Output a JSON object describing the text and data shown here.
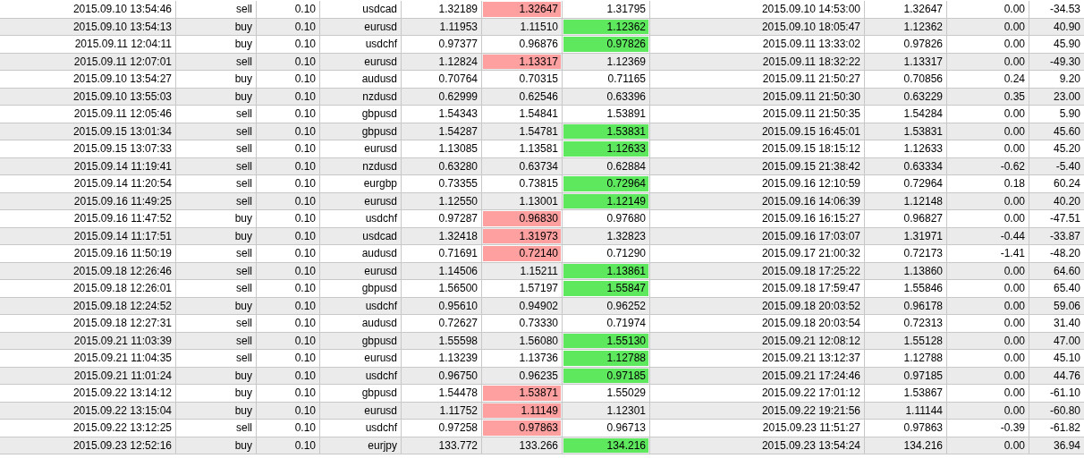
{
  "table": {
    "rows": [
      {
        "cells": [
          "2015.09.10 13:54:46",
          "sell",
          "0.10",
          "usdcad",
          "1.32189",
          "1.32647",
          "1.31795",
          "2015.09.10 14:53:00",
          "1.32647",
          "0.00",
          "-34.53"
        ],
        "column_6_hit": true,
        "column_7_hit": false
      },
      {
        "cells": [
          "2015.09.10 13:54:13",
          "buy",
          "0.10",
          "eurusd",
          "1.11953",
          "1.11510",
          "1.12362",
          "2015.09.10 18:05:47",
          "1.12362",
          "0.00",
          "40.90"
        ],
        "column_6_hit": false,
        "column_7_hit": true
      },
      {
        "cells": [
          "2015.09.11 12:04:11",
          "buy",
          "0.10",
          "usdchf",
          "0.97377",
          "0.96876",
          "0.97826",
          "2015.09.11 13:33:02",
          "0.97826",
          "0.00",
          "45.90"
        ],
        "column_6_hit": false,
        "column_7_hit": true
      },
      {
        "cells": [
          "2015.09.11 12:07:01",
          "sell",
          "0.10",
          "eurusd",
          "1.12824",
          "1.13317",
          "1.12369",
          "2015.09.11 18:32:22",
          "1.13317",
          "0.00",
          "-49.30"
        ],
        "column_6_hit": true,
        "column_7_hit": false
      },
      {
        "cells": [
          "2015.09.10 13:54:27",
          "buy",
          "0.10",
          "audusd",
          "0.70764",
          "0.70315",
          "0.71165",
          "2015.09.11 21:50:27",
          "0.70856",
          "0.24",
          "9.20"
        ],
        "column_6_hit": false,
        "column_7_hit": false
      },
      {
        "cells": [
          "2015.09.10 13:55:03",
          "buy",
          "0.10",
          "nzdusd",
          "0.62999",
          "0.62546",
          "0.63396",
          "2015.09.11 21:50:30",
          "0.63229",
          "0.35",
          "23.00"
        ],
        "column_6_hit": false,
        "column_7_hit": false
      },
      {
        "cells": [
          "2015.09.11 12:05:46",
          "sell",
          "0.10",
          "gbpusd",
          "1.54343",
          "1.54841",
          "1.53891",
          "2015.09.11 21:50:35",
          "1.54284",
          "0.00",
          "5.90"
        ],
        "column_6_hit": false,
        "column_7_hit": false
      },
      {
        "cells": [
          "2015.09.15 13:01:34",
          "sell",
          "0.10",
          "gbpusd",
          "1.54287",
          "1.54781",
          "1.53831",
          "2015.09.15 16:45:01",
          "1.53831",
          "0.00",
          "45.60"
        ],
        "column_6_hit": false,
        "column_7_hit": true
      },
      {
        "cells": [
          "2015.09.15 13:07:33",
          "sell",
          "0.10",
          "eurusd",
          "1.13085",
          "1.13581",
          "1.12633",
          "2015.09.15 18:15:12",
          "1.12633",
          "0.00",
          "45.20"
        ],
        "column_6_hit": false,
        "column_7_hit": true
      },
      {
        "cells": [
          "2015.09.14 11:19:41",
          "sell",
          "0.10",
          "nzdusd",
          "0.63280",
          "0.63734",
          "0.62884",
          "2015.09.15 21:38:42",
          "0.63334",
          "-0.62",
          "-5.40"
        ],
        "column_6_hit": false,
        "column_7_hit": false
      },
      {
        "cells": [
          "2015.09.14 11:20:54",
          "sell",
          "0.10",
          "eurgbp",
          "0.73355",
          "0.73815",
          "0.72964",
          "2015.09.16 12:10:59",
          "0.72964",
          "0.18",
          "60.24"
        ],
        "column_6_hit": false,
        "column_7_hit": true
      },
      {
        "cells": [
          "2015.09.16 11:49:25",
          "sell",
          "0.10",
          "eurusd",
          "1.12550",
          "1.13001",
          "1.12149",
          "2015.09.16 14:06:39",
          "1.12148",
          "0.00",
          "40.20"
        ],
        "column_6_hit": false,
        "column_7_hit": true
      },
      {
        "cells": [
          "2015.09.16 11:47:52",
          "buy",
          "0.10",
          "usdchf",
          "0.97287",
          "0.96830",
          "0.97680",
          "2015.09.16 16:15:27",
          "0.96827",
          "0.00",
          "-47.51"
        ],
        "column_6_hit": true,
        "column_7_hit": false
      },
      {
        "cells": [
          "2015.09.14 11:17:51",
          "buy",
          "0.10",
          "usdcad",
          "1.32418",
          "1.31973",
          "1.32823",
          "2015.09.16 17:03:07",
          "1.31971",
          "-0.44",
          "-33.87"
        ],
        "column_6_hit": true,
        "column_7_hit": false
      },
      {
        "cells": [
          "2015.09.16 11:50:19",
          "sell",
          "0.10",
          "audusd",
          "0.71691",
          "0.72140",
          "0.71290",
          "2015.09.17 21:00:32",
          "0.72173",
          "-1.41",
          "-48.20"
        ],
        "column_6_hit": true,
        "column_7_hit": false
      },
      {
        "cells": [
          "2015.09.18 12:26:46",
          "sell",
          "0.10",
          "eurusd",
          "1.14506",
          "1.15211",
          "1.13861",
          "2015.09.18 17:25:22",
          "1.13860",
          "0.00",
          "64.60"
        ],
        "column_6_hit": false,
        "column_7_hit": true
      },
      {
        "cells": [
          "2015.09.18 12:26:01",
          "sell",
          "0.10",
          "gbpusd",
          "1.56500",
          "1.57197",
          "1.55847",
          "2015.09.18 17:59:47",
          "1.55846",
          "0.00",
          "65.40"
        ],
        "column_6_hit": false,
        "column_7_hit": true
      },
      {
        "cells": [
          "2015.09.18 12:24:52",
          "buy",
          "0.10",
          "usdchf",
          "0.95610",
          "0.94902",
          "0.96252",
          "2015.09.18 20:03:52",
          "0.96178",
          "0.00",
          "59.06"
        ],
        "column_6_hit": false,
        "column_7_hit": false
      },
      {
        "cells": [
          "2015.09.18 12:27:31",
          "sell",
          "0.10",
          "audusd",
          "0.72627",
          "0.73330",
          "0.71974",
          "2015.09.18 20:03:54",
          "0.72313",
          "0.00",
          "31.40"
        ],
        "column_6_hit": false,
        "column_7_hit": false
      },
      {
        "cells": [
          "2015.09.21 11:03:39",
          "sell",
          "0.10",
          "gbpusd",
          "1.55598",
          "1.56080",
          "1.55130",
          "2015.09.21 12:08:12",
          "1.55128",
          "0.00",
          "47.00"
        ],
        "column_6_hit": false,
        "column_7_hit": true
      },
      {
        "cells": [
          "2015.09.21 11:04:35",
          "sell",
          "0.10",
          "eurusd",
          "1.13239",
          "1.13736",
          "1.12788",
          "2015.09.21 13:12:37",
          "1.12788",
          "0.00",
          "45.10"
        ],
        "column_6_hit": false,
        "column_7_hit": true
      },
      {
        "cells": [
          "2015.09.21 11:01:24",
          "buy",
          "0.10",
          "usdchf",
          "0.96750",
          "0.96235",
          "0.97185",
          "2015.09.21 17:24:46",
          "0.97185",
          "0.00",
          "44.76"
        ],
        "column_6_hit": false,
        "column_7_hit": true
      },
      {
        "cells": [
          "2015.09.22 13:14:12",
          "buy",
          "0.10",
          "gbpusd",
          "1.54478",
          "1.53871",
          "1.55029",
          "2015.09.22 17:01:12",
          "1.53867",
          "0.00",
          "-61.10"
        ],
        "column_6_hit": true,
        "column_7_hit": false
      },
      {
        "cells": [
          "2015.09.22 13:15:04",
          "buy",
          "0.10",
          "eurusd",
          "1.11752",
          "1.11149",
          "1.12301",
          "2015.09.22 19:21:56",
          "1.11144",
          "0.00",
          "-60.80"
        ],
        "column_6_hit": true,
        "column_7_hit": false
      },
      {
        "cells": [
          "2015.09.22 13:12:25",
          "sell",
          "0.10",
          "usdchf",
          "0.97258",
          "0.97863",
          "0.96713",
          "2015.09.23 11:51:27",
          "0.97863",
          "-0.39",
          "-61.82"
        ],
        "column_6_hit": true,
        "column_7_hit": false
      },
      {
        "cells": [
          "2015.09.23 12:52:16",
          "buy",
          "0.10",
          "eurjpy",
          "133.772",
          "133.266",
          "134.216",
          "2015.09.23 13:54:24",
          "134.216",
          "0.00",
          "36.94"
        ],
        "column_6_hit": false,
        "column_7_hit": true
      }
    ]
  }
}
